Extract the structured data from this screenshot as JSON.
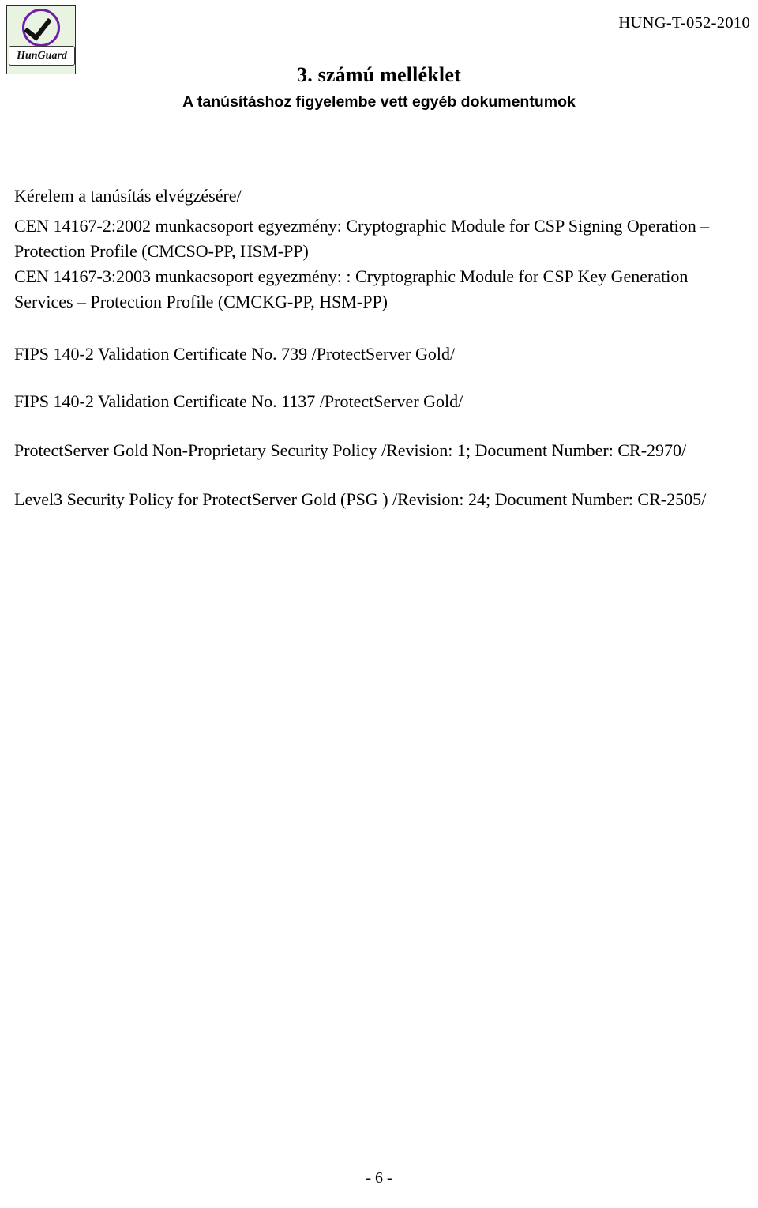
{
  "header": {
    "doc_id": "HUNG-T-052-2010",
    "logo": {
      "icon": "checkmark-oval-icon",
      "wordmark": "HunGuard"
    }
  },
  "title": {
    "main": "3. számú melléklet",
    "sub": "A tanúsításhoz figyelembe vett egyéb dokumentumok"
  },
  "body": {
    "lead": "Kérelem a tanúsítás elvégzésére/",
    "items": [
      "CEN 14167-2:2002 munkacsoport egyezmény: Cryptographic Module for CSP Signing Operation – Protection Profile (CMCSO-PP, HSM-PP)",
      "CEN 14167-3:2003 munkacsoport egyezmény: : Cryptographic Module for CSP Key Generation Services – Protection Profile (CMCKG-PP, HSM-PP)",
      "FIPS 140-2 Validation Certificate No. 739 /ProtectServer Gold/",
      "FIPS 140-2 Validation Certificate No. 1137 /ProtectServer Gold/",
      "ProtectServer Gold Non-Proprietary Security Policy /Revision: 1; Document Number: CR-2970/",
      "Level3 Security Policy for ProtectServer Gold (PSG ) /Revision: 24; Document Number: CR-2505/"
    ]
  },
  "footer": {
    "page_number": "- 6 -"
  }
}
